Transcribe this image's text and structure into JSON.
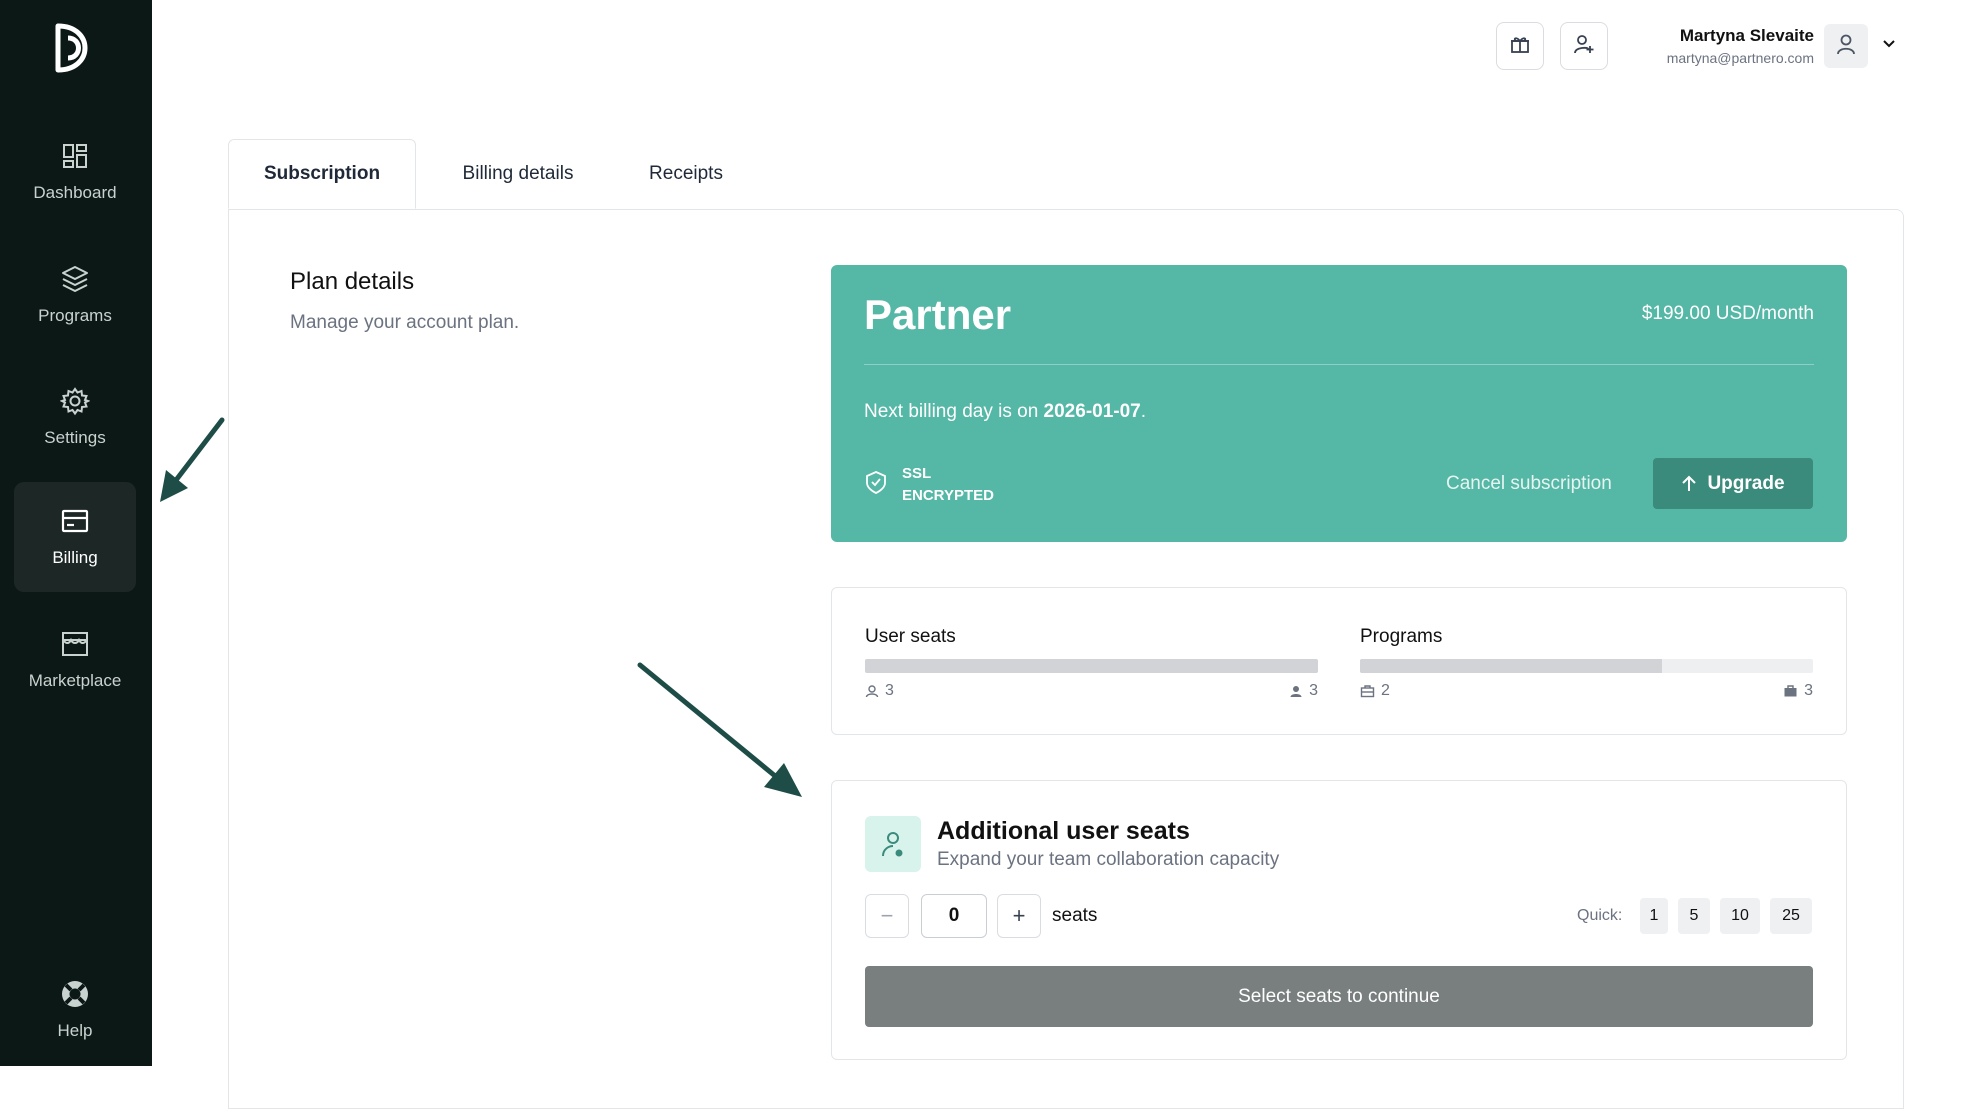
{
  "sidebar": {
    "logo_icon": "partnero-logo-icon",
    "items": [
      {
        "label": "Dashboard",
        "icon": "dashboard-icon",
        "active": false
      },
      {
        "label": "Programs",
        "icon": "layers-icon",
        "active": false
      },
      {
        "label": "Settings",
        "icon": "gear-icon",
        "active": false
      },
      {
        "label": "Billing",
        "icon": "billing-icon",
        "active": true
      },
      {
        "label": "Marketplace",
        "icon": "store-icon",
        "active": false
      }
    ],
    "help": {
      "label": "Help",
      "icon": "lifebuoy-icon"
    }
  },
  "topbar": {
    "gift_icon": "gift-icon",
    "invite_icon": "add-user-icon",
    "user_name": "Martyna Slevaite",
    "user_email": "martyna@partnero.com",
    "avatar_icon": "user-icon"
  },
  "tabs": [
    {
      "label": "Subscription",
      "active": true
    },
    {
      "label": "Billing details",
      "active": false
    },
    {
      "label": "Receipts",
      "active": false
    }
  ],
  "plan_section": {
    "title": "Plan details",
    "subtitle": "Manage your account plan."
  },
  "plan_card": {
    "name": "Partner",
    "price": "$199.00 USD/month",
    "billing_prefix": "Next billing day is on ",
    "billing_date": "2026-01-07",
    "billing_suffix": ".",
    "ssl_line1": "SSL",
    "ssl_line2": "ENCRYPTED",
    "cancel_label": "Cancel subscription",
    "upgrade_label": "Upgrade",
    "color": "#55b7a5"
  },
  "usage": {
    "user_seats": {
      "label": "User seats",
      "used": "3",
      "total": "3",
      "fill_fraction": 1.0
    },
    "programs": {
      "label": "Programs",
      "used": "2",
      "total": "3",
      "fill_fraction": 0.6667
    }
  },
  "additional_seats": {
    "title": "Additional user seats",
    "subtitle": "Expand your team collaboration capacity",
    "minus_label": "−",
    "plus_label": "+",
    "value": "0",
    "unit": "seats",
    "quick_label": "Quick:",
    "quick_options": [
      "1",
      "5",
      "10",
      "25"
    ],
    "continue_label": "Select seats to continue"
  }
}
